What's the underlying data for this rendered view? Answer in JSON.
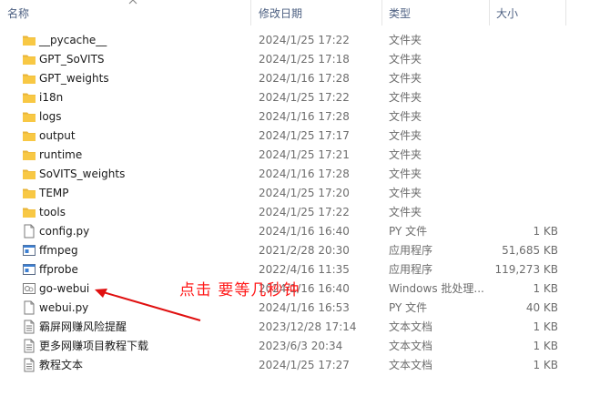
{
  "columns": {
    "name": "名称",
    "date": "修改日期",
    "type": "类型",
    "size": "大小"
  },
  "files": [
    {
      "name": "__pycache__",
      "date": "2024/1/25 17:22",
      "type": "文件夹",
      "size": "",
      "icon": "folder-icon"
    },
    {
      "name": "GPT_SoVITS",
      "date": "2024/1/25 17:18",
      "type": "文件夹",
      "size": "",
      "icon": "folder-icon"
    },
    {
      "name": "GPT_weights",
      "date": "2024/1/16 17:28",
      "type": "文件夹",
      "size": "",
      "icon": "folder-icon"
    },
    {
      "name": "i18n",
      "date": "2024/1/25 17:22",
      "type": "文件夹",
      "size": "",
      "icon": "folder-icon"
    },
    {
      "name": "logs",
      "date": "2024/1/16 17:28",
      "type": "文件夹",
      "size": "",
      "icon": "folder-icon"
    },
    {
      "name": "output",
      "date": "2024/1/25 17:17",
      "type": "文件夹",
      "size": "",
      "icon": "folder-icon"
    },
    {
      "name": "runtime",
      "date": "2024/1/25 17:21",
      "type": "文件夹",
      "size": "",
      "icon": "folder-icon"
    },
    {
      "name": "SoVITS_weights",
      "date": "2024/1/16 17:28",
      "type": "文件夹",
      "size": "",
      "icon": "folder-icon"
    },
    {
      "name": "TEMP",
      "date": "2024/1/25 17:20",
      "type": "文件夹",
      "size": "",
      "icon": "folder-icon"
    },
    {
      "name": "tools",
      "date": "2024/1/25 17:22",
      "type": "文件夹",
      "size": "",
      "icon": "folder-icon"
    },
    {
      "name": "config.py",
      "date": "2024/1/16 16:40",
      "type": "PY 文件",
      "size": "1 KB",
      "icon": "file-icon"
    },
    {
      "name": "ffmpeg",
      "date": "2021/2/28 20:30",
      "type": "应用程序",
      "size": "51,685 KB",
      "icon": "app-icon"
    },
    {
      "name": "ffprobe",
      "date": "2022/4/16 11:35",
      "type": "应用程序",
      "size": "119,273 KB",
      "icon": "app-icon"
    },
    {
      "name": "go-webui",
      "date": "2024/1/16 16:40",
      "type": "Windows 批处理...",
      "size": "1 KB",
      "icon": "batch-file-icon"
    },
    {
      "name": "webui.py",
      "date": "2024/1/16 16:53",
      "type": "PY 文件",
      "size": "40 KB",
      "icon": "file-icon"
    },
    {
      "name": "霸屏网赚风险提醒",
      "date": "2023/12/28 17:14",
      "type": "文本文档",
      "size": "1 KB",
      "icon": "text-file-icon"
    },
    {
      "name": "更多网赚项目教程下载",
      "date": "2023/6/3 20:34",
      "type": "文本文档",
      "size": "1 KB",
      "icon": "text-file-icon"
    },
    {
      "name": "教程文本",
      "date": "2024/1/25 17:27",
      "type": "文本文档",
      "size": "1 KB",
      "icon": "text-file-icon"
    }
  ],
  "annotation": {
    "text": "点击  要等几秒钟",
    "color": "#ff1a1a"
  },
  "colors": {
    "folder": "#f8c844",
    "header_text": "#4d6082"
  }
}
